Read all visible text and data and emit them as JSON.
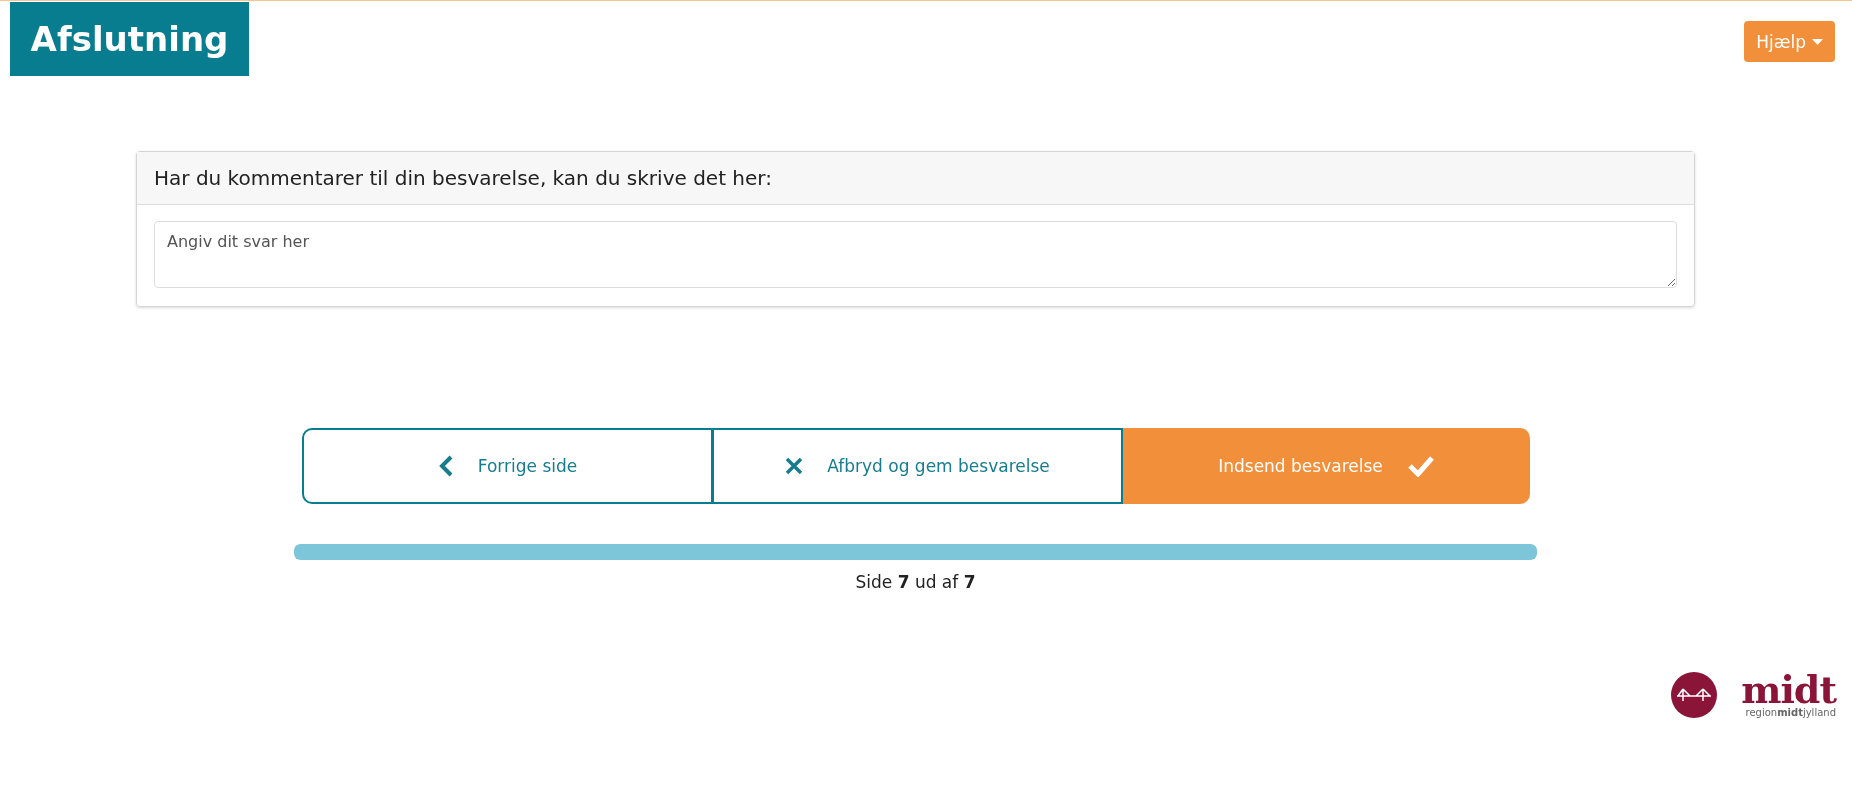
{
  "header": {
    "title": "Afslutning",
    "help_button": "Hjælp"
  },
  "question": {
    "label": "Har du kommentarer til din besvarelse, kan du skrive det her:",
    "placeholder": "Angiv dit svar her"
  },
  "nav_buttons": [
    {
      "kind": "back",
      "label": "Forrige side"
    },
    {
      "kind": "cancel",
      "label": "Afbryd og gem besvarelse"
    },
    {
      "kind": "submit",
      "label": "Indsend besvarelse"
    }
  ],
  "progress": {
    "level": 1,
    "text": "Side **7** ud af **7**"
  },
  "logo": {
    "wordmark": "midt",
    "tagline_parts": [
      "region",
      "midt",
      "jylland"
    ]
  }
}
